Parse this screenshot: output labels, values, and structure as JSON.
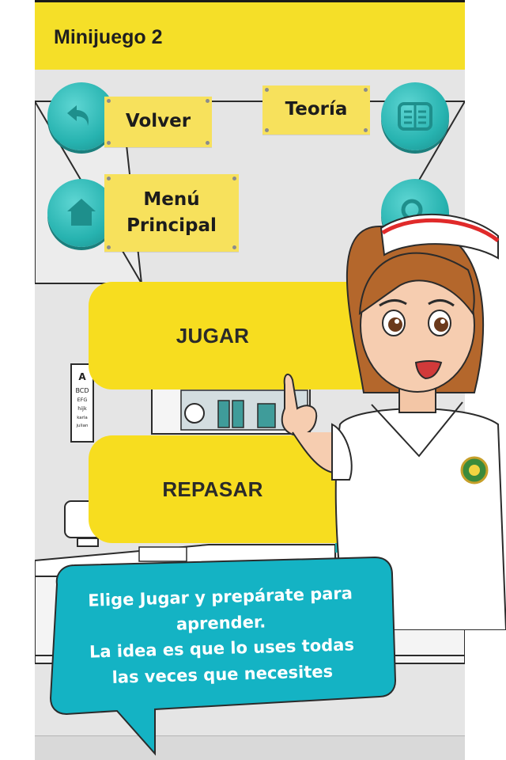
{
  "topbar": {
    "title": "Minijuego 2"
  },
  "buttons": {
    "volver": "Volver",
    "teoria": "Teoría",
    "menu_line1": "Menú",
    "menu_line2": "Principal",
    "jugar": "JUGAR",
    "repasar": "REPASAR"
  },
  "icons": {
    "back": "back-arrow-icon",
    "theory": "book-icon",
    "home": "home-icon",
    "search": "search-icon"
  },
  "chart_eye": [
    "A",
    "BCD",
    "EFG",
    "hijk",
    "karla",
    "julian"
  ],
  "bubble": {
    "text": "Elige Jugar y prepárate para\naprender.\nLa idea es que lo uses  todas\nlas veces que necesites"
  },
  "colors": {
    "topbar": "#f5df28",
    "accent_teal": "#27b3b0",
    "button_yellow": "#f7dd1f",
    "sticky_yellow": "#f7e15c",
    "bubble_teal": "#14b3c4"
  }
}
